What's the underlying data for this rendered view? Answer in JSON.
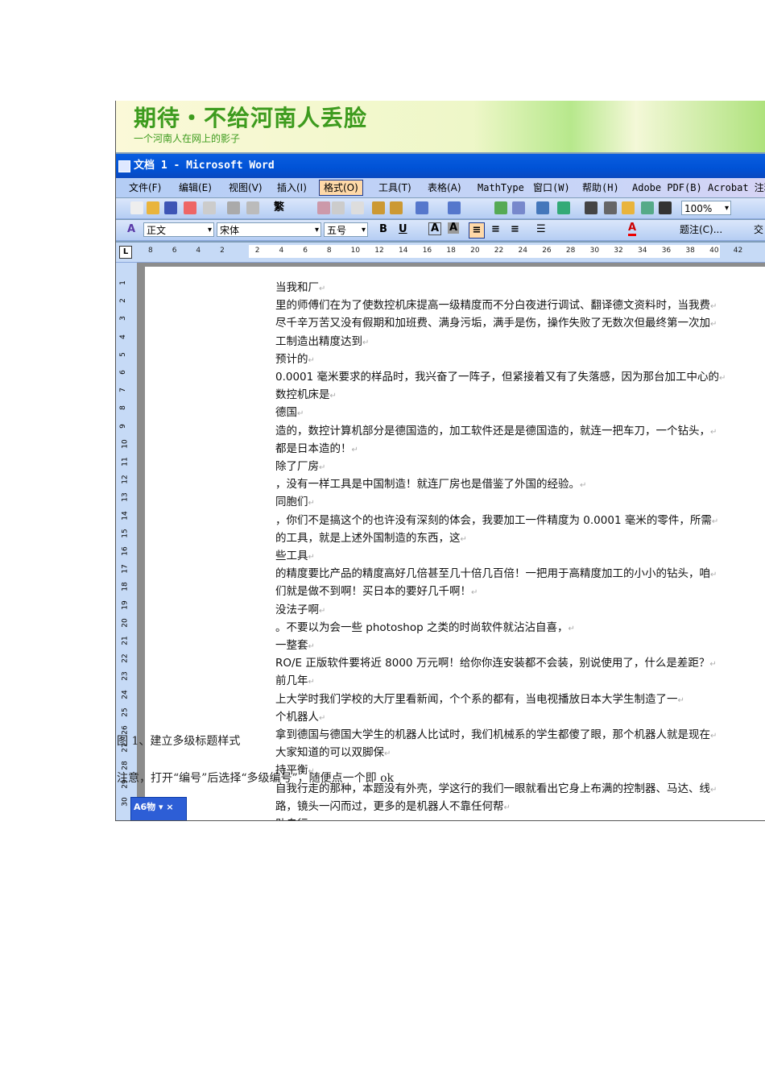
{
  "banner": {
    "title": "期待・不给河南人丢脸",
    "subtitle": "一个河南人在网上的影子"
  },
  "window": {
    "title": "文档 1 - Microsoft Word"
  },
  "menu": [
    "文件(F)",
    "编辑(E)",
    "视图(V)",
    "插入(I)",
    "格式(O)",
    "工具(T)",
    "表格(A)",
    "MathType",
    "窗口(W)",
    "帮助(H)",
    "Adobe PDF(B)",
    "Acrobat 注释"
  ],
  "active_menu": "格式(O)",
  "toolbar": {
    "zoom": "100%",
    "traditional": "繁"
  },
  "format_toolbar": {
    "style": "正文",
    "font": "宋体",
    "size": "五号",
    "bold": "B",
    "underline": "U",
    "caption": "题注(C)...",
    "more": "交"
  },
  "ruler": {
    "tab_selector": "L",
    "numbers": [
      "8",
      "6",
      "4",
      "2",
      "2",
      "4",
      "6",
      "8",
      "10",
      "12",
      "14",
      "16",
      "18",
      "20",
      "22",
      "24",
      "26",
      "28",
      "30",
      "32",
      "34",
      "36",
      "38",
      "40",
      "42"
    ]
  },
  "vertical_ruler": [
    "1",
    "2",
    "3",
    "4",
    "5",
    "6",
    "7",
    "8",
    "9",
    "10",
    "11",
    "12",
    "13",
    "14",
    "15",
    "16",
    "17",
    "18",
    "19",
    "20",
    "21",
    "22",
    "23",
    "24",
    "25",
    "26",
    "27",
    "28",
    "29",
    "30"
  ],
  "document_lines": [
    "当我和厂",
    "里的师傅们在为了使数控机床提高一级精度而不分白夜进行调试、翻译德文资料时，当我费",
    "尽千辛万苦又没有假期和加班费、满身污垢，满手是伤，操作失败了无数次但最终第一次加",
    "工制造出精度达到",
    "预计的",
    "0.0001 毫米要求的样品时，我兴奋了一阵子，但紧接着又有了失落感，因为那台加工中心的",
    "数控机床是",
    "德国",
    "造的，数控计算机部分是德国造的，加工软件还是是德国造的，就连一把车刀，一个钻头，",
    "都是日本造的！",
    "除了厂房",
    "，没有一样工具是中国制造！就连厂房也是借鉴了外国的经验。",
    "同胞们",
    "，你们不是搞这个的也许没有深刻的体会，我要加工一件精度为 0.0001 毫米的零件，所需",
    "的工具，就是上述外国制造的东西，这",
    "些工具",
    "的精度要比产品的精度高好几倍甚至几十倍几百倍！一把用于高精度加工的小小的钻头，咱",
    "们就是做不到啊！买日本的要好几千啊！",
    "没法子啊",
    "。不要以为会一些 photoshop 之类的时尚软件就沾沾自喜，",
    "一整套",
    "RO/E 正版软件要将近 8000 万元啊！给你你连安装都不会装，别说使用了，什么是差距？",
    "前几年",
    "上大学时我们学校的大厅里看新闻，个个系的都有，当电视播放日本大学生制造了一",
    "个机器人",
    "拿到德国与德国大学生的机器人比试时，我们机械系的学生都傻了眼，那个机器人就是现在",
    "大家知道的可以双脚保",
    "持平衡",
    "自我行走的那种，本题没有外壳，学这行的我们一眼就看出它身上布满的控制器、马达、线",
    "路，镜头一闪而过，更多的是机器人不靠任何帮",
    "助自行"
  ],
  "paragraph_mark": "↵",
  "task_pane": {
    "title": "A6物 ▾ ×"
  },
  "captions": {
    "figure": "图 1、建立多级标题样式",
    "note": "注意，打开“编号”后选择“多级编号”，随便点一个即 ok"
  }
}
